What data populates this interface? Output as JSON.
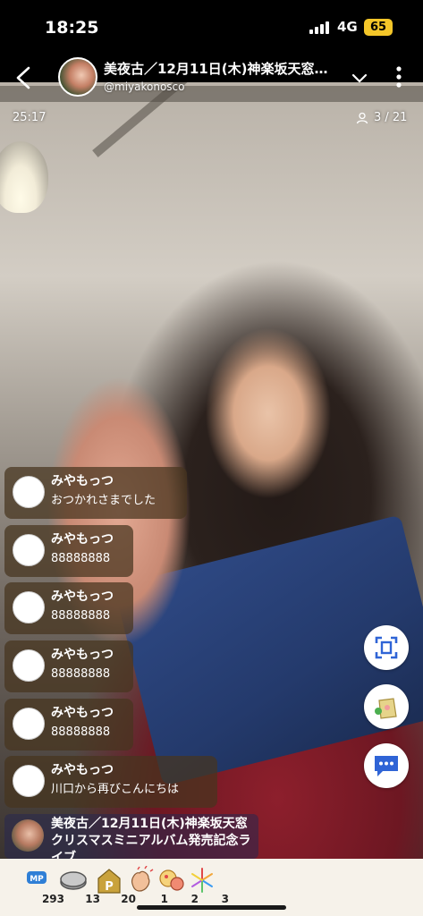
{
  "status_bar": {
    "time": "18:25",
    "network": "4G",
    "battery": "65",
    "battery_color": "#f4c629"
  },
  "header": {
    "title": "美夜古／12月11日(木)神楽坂天窓…",
    "handle": "@miyakonosco",
    "back_icon": "chevron-left-icon",
    "expand_icon": "chevron-down-icon",
    "menu_icon": "more-vertical-icon"
  },
  "stream": {
    "elapsed": "25:17",
    "viewers": "3 / 21",
    "viewers_icon": "person-icon"
  },
  "comments": [
    {
      "name": "みやもっつ",
      "text": "おつかれさまでした"
    },
    {
      "name": "みやもっつ",
      "text": "88888888"
    },
    {
      "name": "みやもっつ",
      "text": "88888888"
    },
    {
      "name": "みやもっつ",
      "text": "88888888"
    },
    {
      "name": "みやもっつ",
      "text": "88888888"
    },
    {
      "name": "みやもっつ",
      "text": "川口から再びこんにちは"
    }
  ],
  "telop": {
    "text": "美夜古／12月11日(木)神楽坂天窓クリスマスミニアルバム発売記念ライブ"
  },
  "side_buttons": [
    {
      "icon": "capture-frame-icon",
      "color": "#2f64d6"
    },
    {
      "icon": "gift-bag-icon",
      "color": "#d7c27a"
    },
    {
      "icon": "chat-bubble-icon",
      "color": "#2f64d6"
    }
  ],
  "gifts": [
    {
      "icon": "mp-points-icon",
      "label": "MP",
      "count": "293"
    },
    {
      "icon": "coin-stack-icon",
      "count": "13"
    },
    {
      "icon": "p-sign-icon",
      "label": "P",
      "count": "20"
    },
    {
      "icon": "clapping-hands-icon",
      "count": "1"
    },
    {
      "icon": "candy-icon",
      "count": "2"
    },
    {
      "icon": "fireworks-icon",
      "count": "3"
    }
  ]
}
